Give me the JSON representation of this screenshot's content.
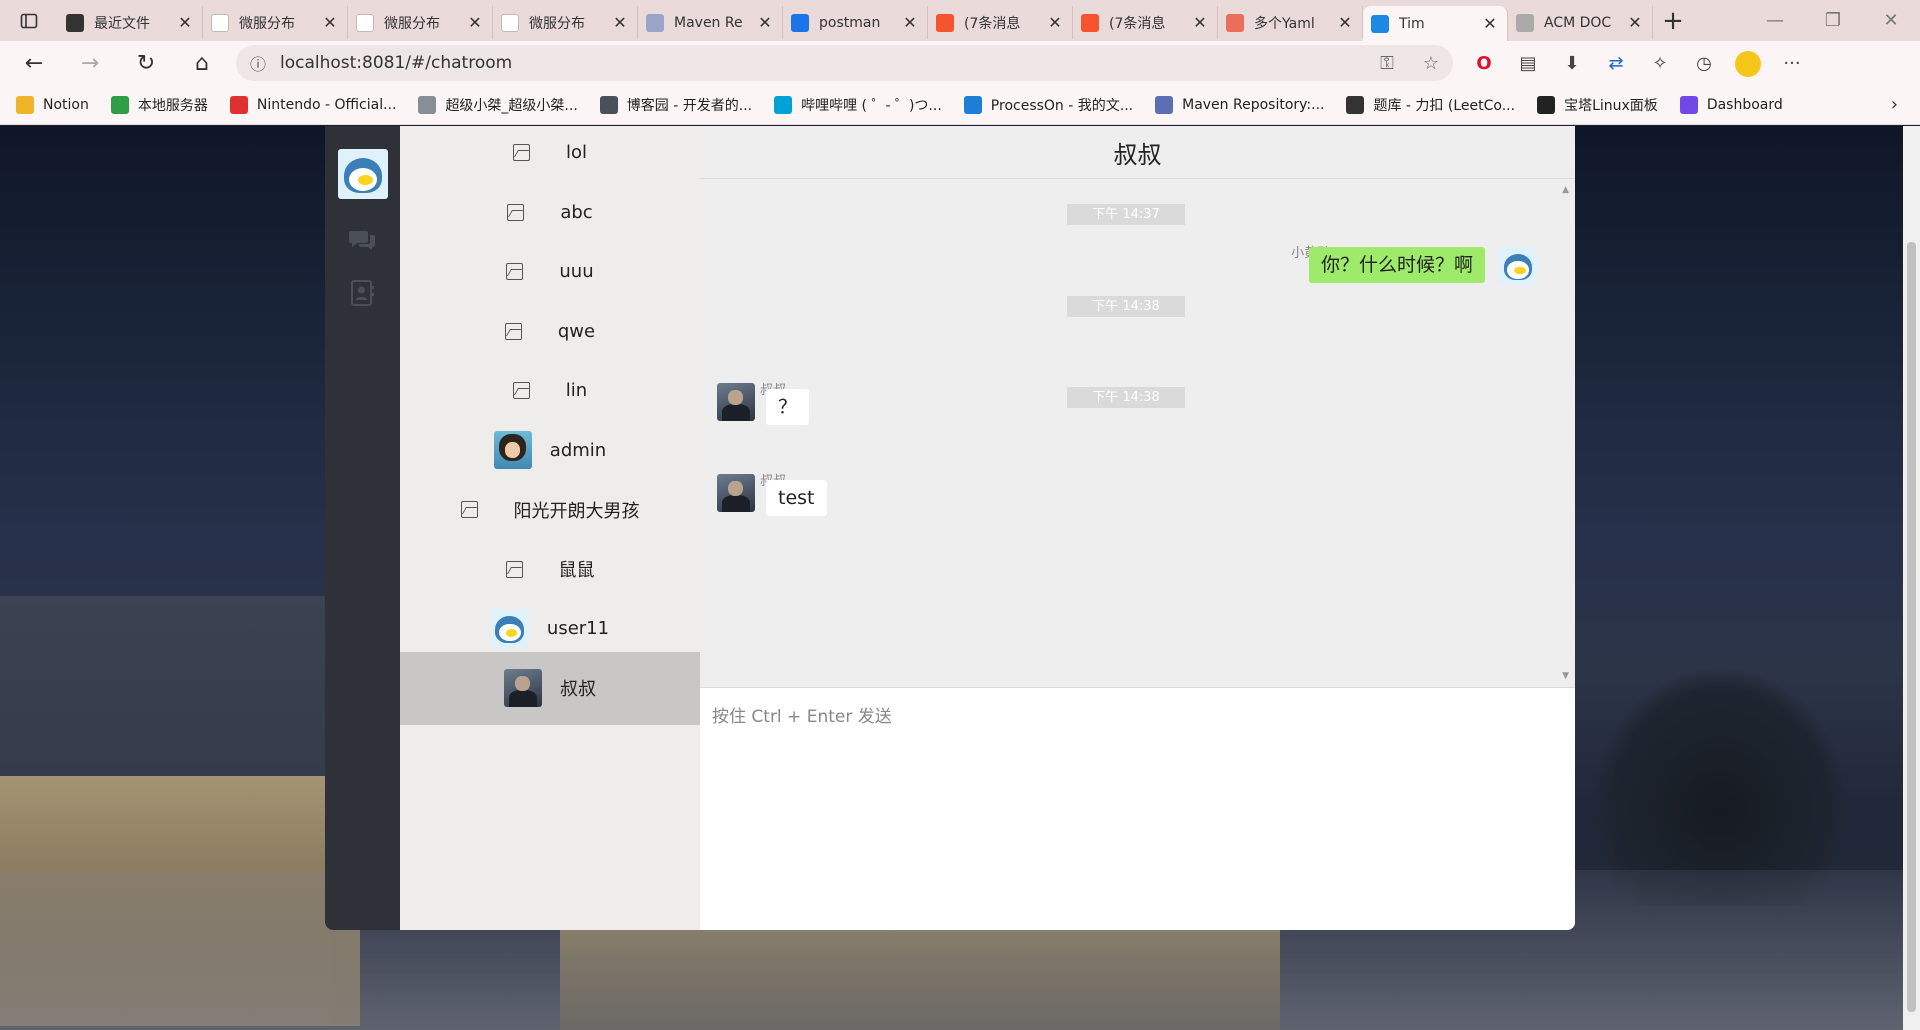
{
  "browser": {
    "tabs": [
      {
        "title": "最近文件",
        "favicon_color": "#333333",
        "favicon": "play-circle"
      },
      {
        "title": "微服分布",
        "favicon_color": "#ffffff",
        "favicon": "doc"
      },
      {
        "title": "微服分布",
        "favicon_color": "#ffffff",
        "favicon": "doc"
      },
      {
        "title": "微服分布",
        "favicon_color": "#ffffff",
        "favicon": "doc"
      },
      {
        "title": "Maven Re",
        "favicon_color": "#9aa3c8",
        "favicon": "mvn"
      },
      {
        "title": "postman",
        "favicon_color": "#1a73e8",
        "favicon": "bing"
      },
      {
        "title": "(7条消息",
        "favicon_color": "#f5542e",
        "favicon": "csdn"
      },
      {
        "title": "(7条消息",
        "favicon_color": "#f5542e",
        "favicon": "csdn"
      },
      {
        "title": "多个Yaml",
        "favicon_color": "#ea6f5a",
        "favicon": "jianshu"
      },
      {
        "title": "Tim",
        "favicon_color": "#1e88e5",
        "favicon": "app",
        "active": true
      },
      {
        "title": "ACM DOC",
        "favicon_color": "#aaaaaa",
        "favicon": "plane"
      }
    ],
    "url": "localhost:8081/#/chatroom",
    "bookmarks": [
      {
        "label": "Notion",
        "color": "#f0b429"
      },
      {
        "label": "本地服务器",
        "color": "#2f9e44"
      },
      {
        "label": "Nintendo - Official...",
        "color": "#e03131"
      },
      {
        "label": "超级小桀_超级小桀...",
        "color": "#868e96"
      },
      {
        "label": "博客园 - 开发者的...",
        "color": "#495057"
      },
      {
        "label": "哔哩哔哩 ( ゜- ゜)つ...",
        "color": "#00a1d6"
      },
      {
        "label": "ProcessOn - 我的文...",
        "color": "#1c7ed6"
      },
      {
        "label": "Maven Repository:...",
        "color": "#5c6fb5"
      },
      {
        "label": "题库 - 力扣 (LeetCo...",
        "color": "#333333"
      },
      {
        "label": "宝塔Linux面板",
        "color": "#222222"
      },
      {
        "label": "Dashboard",
        "color": "#7048e8"
      }
    ]
  },
  "contacts": [
    {
      "name": "lol",
      "avatar": "broken"
    },
    {
      "name": "abc",
      "avatar": "broken"
    },
    {
      "name": "uuu",
      "avatar": "broken"
    },
    {
      "name": "qwe",
      "avatar": "broken"
    },
    {
      "name": "lin",
      "avatar": "broken"
    },
    {
      "name": "admin",
      "avatar": "girl"
    },
    {
      "name": "阳光开朗大男孩",
      "avatar": "broken"
    },
    {
      "name": "鼠鼠",
      "avatar": "broken"
    },
    {
      "name": "user11",
      "avatar": "penguin"
    },
    {
      "name": "叔叔",
      "avatar": "man",
      "active": true
    }
  ],
  "chat": {
    "title": "叔叔",
    "messages": [
      {
        "time": "下午 14:37",
        "sender": "小黄鸭258",
        "text": "你？什么时候？啊",
        "self": true
      },
      {
        "time": "下午 14:38",
        "sender": "叔叔",
        "text": "？",
        "self": false
      },
      {
        "time": "下午 14:38",
        "sender": "叔叔",
        "text": "test",
        "self": false
      }
    ],
    "input_placeholder": "按住 Ctrl + Enter 发送"
  }
}
